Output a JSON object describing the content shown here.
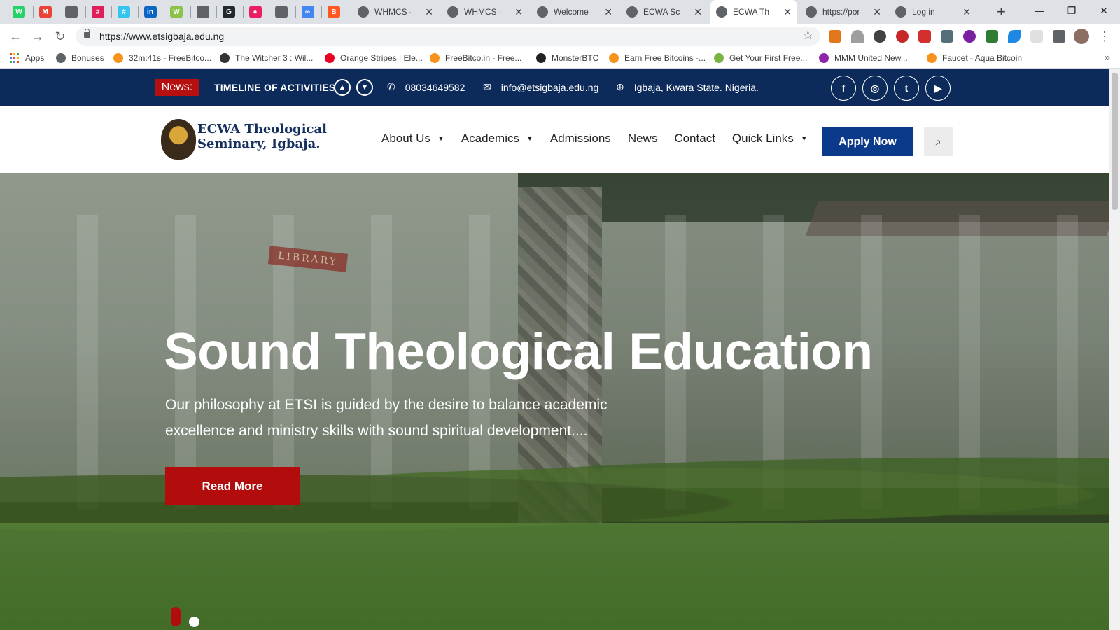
{
  "browser": {
    "pinned_tabs": [
      {
        "icon": "whatsapp-icon",
        "color": "#25d366",
        "glyph": "W"
      },
      {
        "icon": "gmail-icon",
        "color": "#ea4335",
        "glyph": "M"
      },
      {
        "icon": "globe-icon",
        "color": "#5f6368",
        "glyph": ""
      },
      {
        "icon": "slack-icon",
        "color": "#e01e5a",
        "glyph": "#"
      },
      {
        "icon": "slack-icon",
        "color": "#36c5f0",
        "glyph": "#"
      },
      {
        "icon": "linkedin-icon",
        "color": "#0a66c2",
        "glyph": "in"
      },
      {
        "icon": "whmcs-icon",
        "color": "#8bc34a",
        "glyph": "W"
      },
      {
        "icon": "globe-icon",
        "color": "#5f6368",
        "glyph": ""
      },
      {
        "icon": "github-icon",
        "color": "#24292e",
        "glyph": "G"
      },
      {
        "icon": "record-icon",
        "color": "#e91e63",
        "glyph": "●"
      },
      {
        "icon": "globe-icon",
        "color": "#5f6368",
        "glyph": ""
      },
      {
        "icon": "link-icon",
        "color": "#4285f4",
        "glyph": "∞"
      },
      {
        "icon": "blogger-icon",
        "color": "#ff5722",
        "glyph": "B"
      }
    ],
    "tabs": [
      {
        "title": "WHMCS - Sc",
        "icon": "globe-icon",
        "active": false
      },
      {
        "title": "WHMCS - Sc",
        "icon": "globe-icon",
        "active": false
      },
      {
        "title": "Welcome to",
        "icon": "thumbs-icon",
        "active": false
      },
      {
        "title": "ECWA Schoo",
        "icon": "school-icon",
        "active": false
      },
      {
        "title": "ECWA Theol",
        "icon": "seminary-icon",
        "active": true
      },
      {
        "title": "https://port",
        "icon": "globe-icon",
        "active": false
      },
      {
        "title": "Log in",
        "icon": "leaf-icon",
        "active": false
      }
    ],
    "new_tab_label": "+",
    "window_controls": {
      "minimize": "—",
      "restore": "❐",
      "close": "✕"
    },
    "url": "https://www.etsigbaja.edu.ng",
    "bookmarks": [
      {
        "label": "Apps",
        "icon": "apps-grid-icon"
      },
      {
        "label": "Bonuses",
        "icon": "globe-icon"
      },
      {
        "label": "32m:41s - FreeBitco...",
        "icon": "bitcoin-icon"
      },
      {
        "label": "The Witcher 3 : Wil...",
        "icon": "witcher-icon"
      },
      {
        "label": "Orange Stripes | Ele...",
        "icon": "pinterest-icon"
      },
      {
        "label": "FreeBitco.in - Free...",
        "icon": "bitcoin-icon"
      },
      {
        "label": "MonsterBTC",
        "icon": "monster-icon"
      },
      {
        "label": "Earn Free Bitcoins -...",
        "icon": "bitcoin-icon"
      },
      {
        "label": "Get Your First Free...",
        "icon": "square-icon"
      },
      {
        "label": "MMM United New...",
        "icon": "mmm-icon"
      },
      {
        "label": "Faucet - Aqua Bitcoin",
        "icon": "bitcoin-icon"
      }
    ],
    "bookmarks_more": "»"
  },
  "topbar": {
    "news_label": "News:",
    "news_headline": "TIMELINE OF ACTIVITIES",
    "phone": "08034649582",
    "email": "info@etsigbaja.edu.ng",
    "location": "Igbaja, Kwara State. Nigeria.",
    "social": [
      {
        "name": "facebook-icon",
        "glyph": "f"
      },
      {
        "name": "instagram-icon",
        "glyph": "◎"
      },
      {
        "name": "twitter-icon",
        "glyph": "t"
      },
      {
        "name": "youtube-icon",
        "glyph": "▶"
      }
    ]
  },
  "header": {
    "logo_line1": "ECWA Theological",
    "logo_line2": "Seminary, Igbaja.",
    "nav": [
      {
        "label": "About Us",
        "dropdown": true
      },
      {
        "label": "Academics",
        "dropdown": true
      },
      {
        "label": "Admissions",
        "dropdown": false
      },
      {
        "label": "News",
        "dropdown": false
      },
      {
        "label": "Contact",
        "dropdown": false
      },
      {
        "label": "Quick Links",
        "dropdown": true
      }
    ],
    "apply_label": "Apply Now"
  },
  "hero": {
    "sign_text": "LIBRARY",
    "title": "Sound Theological Education",
    "subtitle": "Our philosophy at ETSI is guided by the desire to balance academic excellence and ministry skills with sound spiritual development....",
    "button_label": "Read More",
    "slide_count": 2,
    "active_slide": 1
  },
  "colors": {
    "topbar": "#0c2a5a",
    "news_badge": "#b50f0f",
    "apply_button": "#0c3a8a",
    "read_more": "#b30c0c",
    "logo_text": "#16305e"
  }
}
